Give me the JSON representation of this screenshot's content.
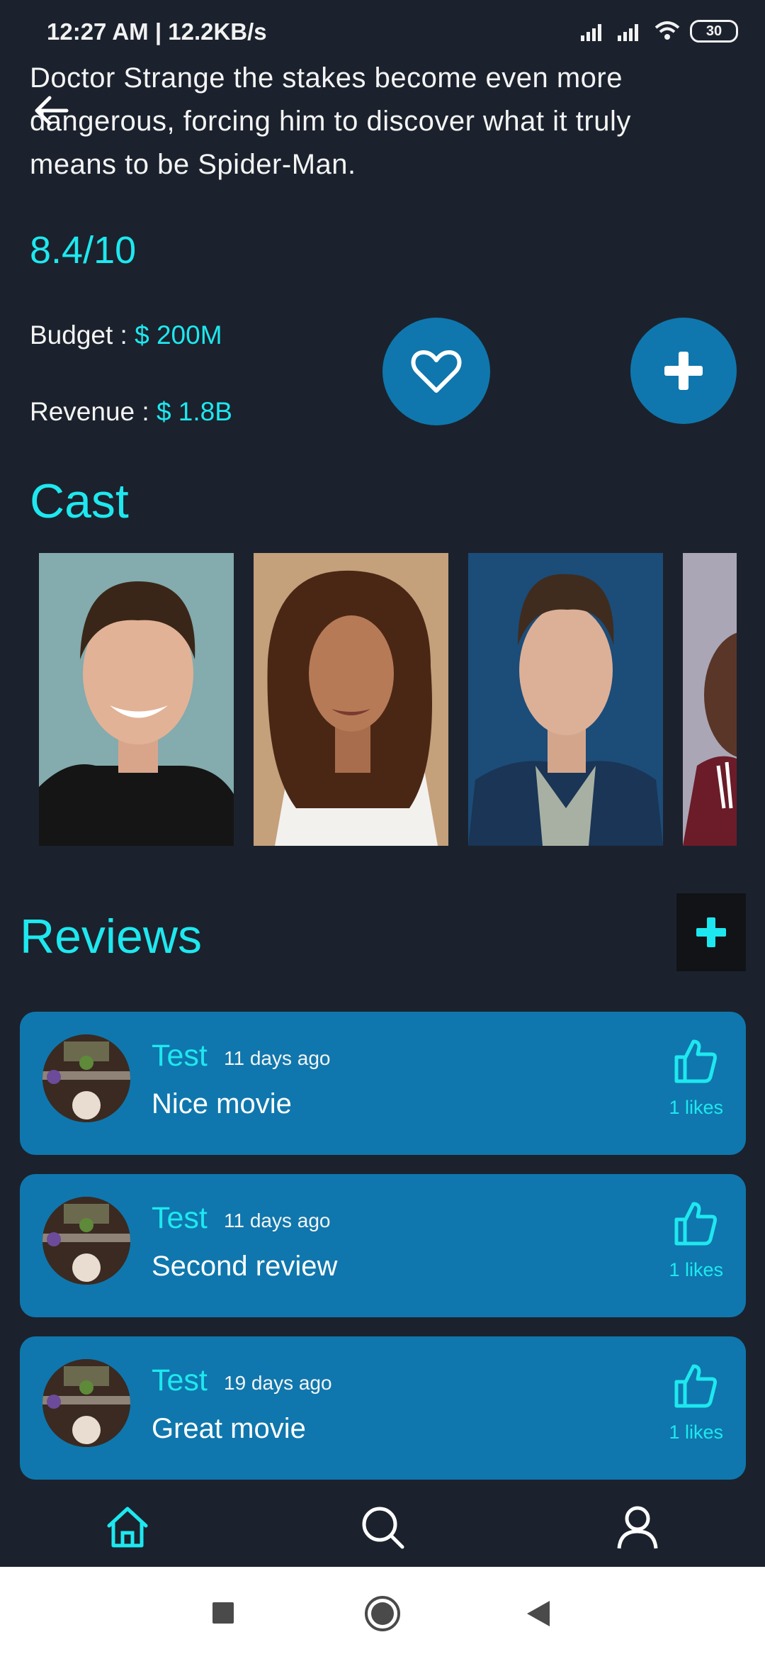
{
  "status_bar": {
    "time": "12:27 AM | 12.2KB/s",
    "battery": "30"
  },
  "movie": {
    "overview": "Doctor Strange the stakes become even more dangerous, forcing him to discover what it truly means to be Spider-Man.",
    "rating": "8.4/10",
    "budget_label": "Budget : ",
    "budget_value": "$ 200M",
    "revenue_label": "Revenue : ",
    "revenue_value": "$ 1.8B"
  },
  "cast": {
    "title": "Cast"
  },
  "reviews": {
    "title": "Reviews",
    "items": [
      {
        "user": "Test",
        "date": "11 days ago",
        "text": "Nice movie",
        "likes": "1 likes"
      },
      {
        "user": "Test",
        "date": "11 days ago",
        "text": "Second review",
        "likes": "1 likes"
      },
      {
        "user": "Test",
        "date": "19 days ago",
        "text": "Great movie",
        "likes": "1 likes"
      }
    ]
  },
  "colors": {
    "background": "#1b222d",
    "accent": "#1ee8ef",
    "card": "#0f77ad"
  },
  "icons": {
    "back": "arrow-left-icon",
    "favorite": "heart-icon",
    "add": "plus-icon",
    "like": "thumbs-up-icon",
    "nav": [
      "home-icon",
      "search-icon",
      "user-icon"
    ]
  }
}
